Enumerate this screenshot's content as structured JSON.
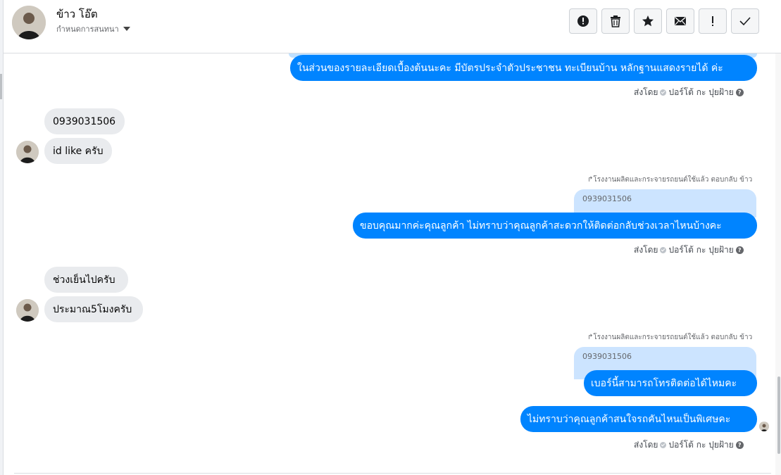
{
  "contact": {
    "name": "ข้าว โอ๊ต",
    "settings_label": "กำหนดการสนทนา"
  },
  "toolbar": [
    {
      "icon": "alert-circle-icon"
    },
    {
      "icon": "trash-icon"
    },
    {
      "icon": "star-icon"
    },
    {
      "icon": "mail-icon"
    },
    {
      "icon": "exclamation-icon"
    },
    {
      "icon": "checkmark-icon"
    }
  ],
  "messages": {
    "m1": {
      "text": "ในส่วนของรายละเอียดเบื้องต้นนะคะ มีบัตรประจำตัวประชาชน ทะเบียนบ้าน หลักฐานแสดงรายได้ ค่ะ"
    },
    "m2": {
      "text": "0939031506"
    },
    "m3": {
      "text": "id like ครับ"
    },
    "m4": {
      "reply_label": "โรงงานผลิตและกระจายรถยนต์ใช้แล้ว ตอบกลับ ข้าว",
      "quote": "0939031506",
      "text": "ขอบคุณมากค่ะคุณลูกค้า ไม่ทราบว่าคุณลูกค้าสะดวกให้ติดต่อกลับช่วงเวลาไหนบ้างคะ"
    },
    "m5": {
      "text": "ช่วงเย็นไปครับ"
    },
    "m6": {
      "text": "ประมาณ5โมงครับ"
    },
    "m7": {
      "reply_label": "โรงงานผลิตและกระจายรถยนต์ใช้แล้ว ตอบกลับ ข้าว",
      "quote": "0939031506",
      "text": "เบอร์นี้สามารถโทรติดต่อได้ไหมคะ"
    },
    "m8": {
      "text": "ไม่ทราบว่าคุณลูกค้าสนใจรถคันไหนเป็นพิเศษคะ"
    }
  },
  "sent_by": {
    "prefix": "ส่งโดย",
    "sender": "ปอร์โต้ กะ ปุยฝ้าย"
  },
  "colors": {
    "outgoing_bubble": "#0084ff",
    "incoming_bubble": "#e9ebee",
    "quote_bubble": "#cce4ff"
  }
}
